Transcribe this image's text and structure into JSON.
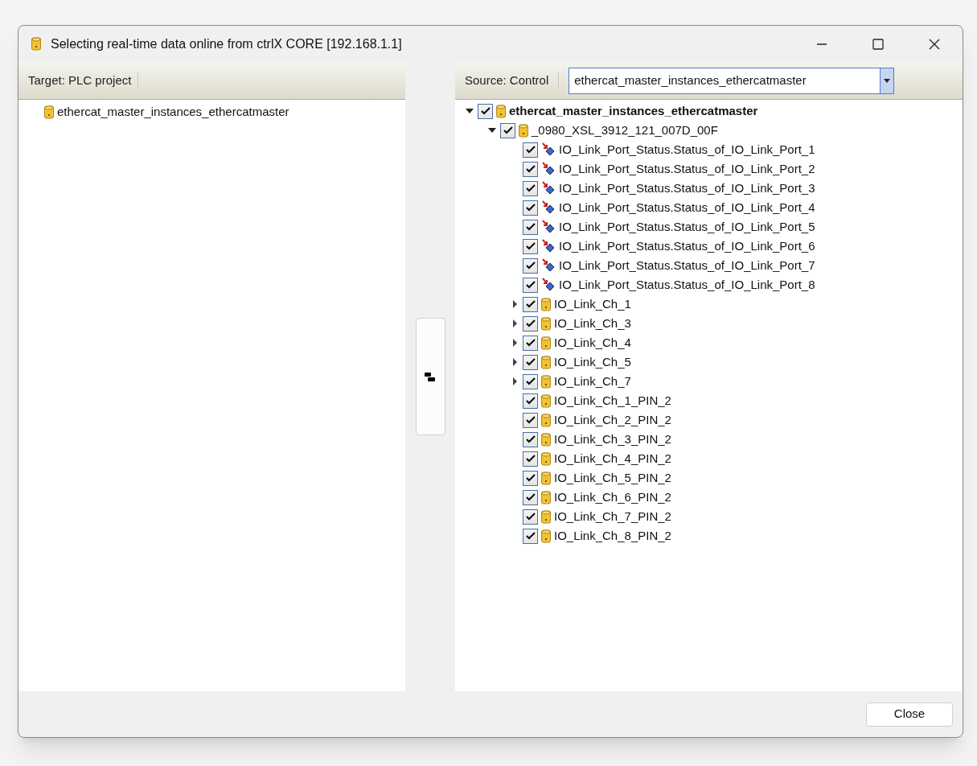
{
  "window": {
    "title": "Selecting real-time data online from ctrlX CORE [192.168.1.1]",
    "controls": [
      {
        "kind": "minimize"
      },
      {
        "kind": "maximize"
      },
      {
        "kind": "close"
      }
    ]
  },
  "target": {
    "label": "Target: PLC project",
    "items": [
      {
        "label": "ethercat_master_instances_ethercatmaster"
      }
    ]
  },
  "source": {
    "label": "Source: Control",
    "dropdown": {
      "value": "ethercat_master_instances_ethercatmaster"
    },
    "tree": [
      {
        "label": "ethercat_master_instances_ethercatmaster",
        "kind": "group",
        "expanded": true,
        "checked": true,
        "bold": true,
        "children": [
          {
            "label": "_0980_XSL_3912_121_007D_00F",
            "kind": "group",
            "expanded": true,
            "checked": true,
            "bold": false,
            "children": [
              {
                "label": "IO_Link_Port_Status.Status_of_IO_Link_Port_1",
                "kind": "variable",
                "checked": true
              },
              {
                "label": "IO_Link_Port_Status.Status_of_IO_Link_Port_2",
                "kind": "variable",
                "checked": true
              },
              {
                "label": "IO_Link_Port_Status.Status_of_IO_Link_Port_3",
                "kind": "variable",
                "checked": true
              },
              {
                "label": "IO_Link_Port_Status.Status_of_IO_Link_Port_4",
                "kind": "variable",
                "checked": true
              },
              {
                "label": "IO_Link_Port_Status.Status_of_IO_Link_Port_5",
                "kind": "variable",
                "checked": true
              },
              {
                "label": "IO_Link_Port_Status.Status_of_IO_Link_Port_6",
                "kind": "variable",
                "checked": true
              },
              {
                "label": "IO_Link_Port_Status.Status_of_IO_Link_Port_7",
                "kind": "variable",
                "checked": true
              },
              {
                "label": "IO_Link_Port_Status.Status_of_IO_Link_Port_8",
                "kind": "variable",
                "checked": true
              },
              {
                "label": "IO_Link_Ch_1",
                "kind": "group",
                "expanded": false,
                "checked": true,
                "bold": false
              },
              {
                "label": "IO_Link_Ch_3",
                "kind": "group",
                "expanded": false,
                "checked": true,
                "bold": false
              },
              {
                "label": "IO_Link_Ch_4",
                "kind": "group",
                "expanded": false,
                "checked": true,
                "bold": false
              },
              {
                "label": "IO_Link_Ch_5",
                "kind": "group",
                "expanded": false,
                "checked": true,
                "bold": false
              },
              {
                "label": "IO_Link_Ch_7",
                "kind": "group",
                "expanded": false,
                "checked": true,
                "bold": false
              },
              {
                "label": "IO_Link_Ch_1_PIN_2",
                "kind": "folder",
                "checked": true
              },
              {
                "label": "IO_Link_Ch_2_PIN_2",
                "kind": "folder",
                "checked": true
              },
              {
                "label": "IO_Link_Ch_3_PIN_2",
                "kind": "folder",
                "checked": true
              },
              {
                "label": "IO_Link_Ch_4_PIN_2",
                "kind": "folder",
                "checked": true
              },
              {
                "label": "IO_Link_Ch_5_PIN_2",
                "kind": "folder",
                "checked": true
              },
              {
                "label": "IO_Link_Ch_6_PIN_2",
                "kind": "folder",
                "checked": true
              },
              {
                "label": "IO_Link_Ch_7_PIN_2",
                "kind": "folder",
                "checked": true
              },
              {
                "label": "IO_Link_Ch_8_PIN_2",
                "kind": "folder",
                "checked": true
              }
            ]
          }
        ]
      }
    ]
  },
  "footer": {
    "button": "Close"
  }
}
